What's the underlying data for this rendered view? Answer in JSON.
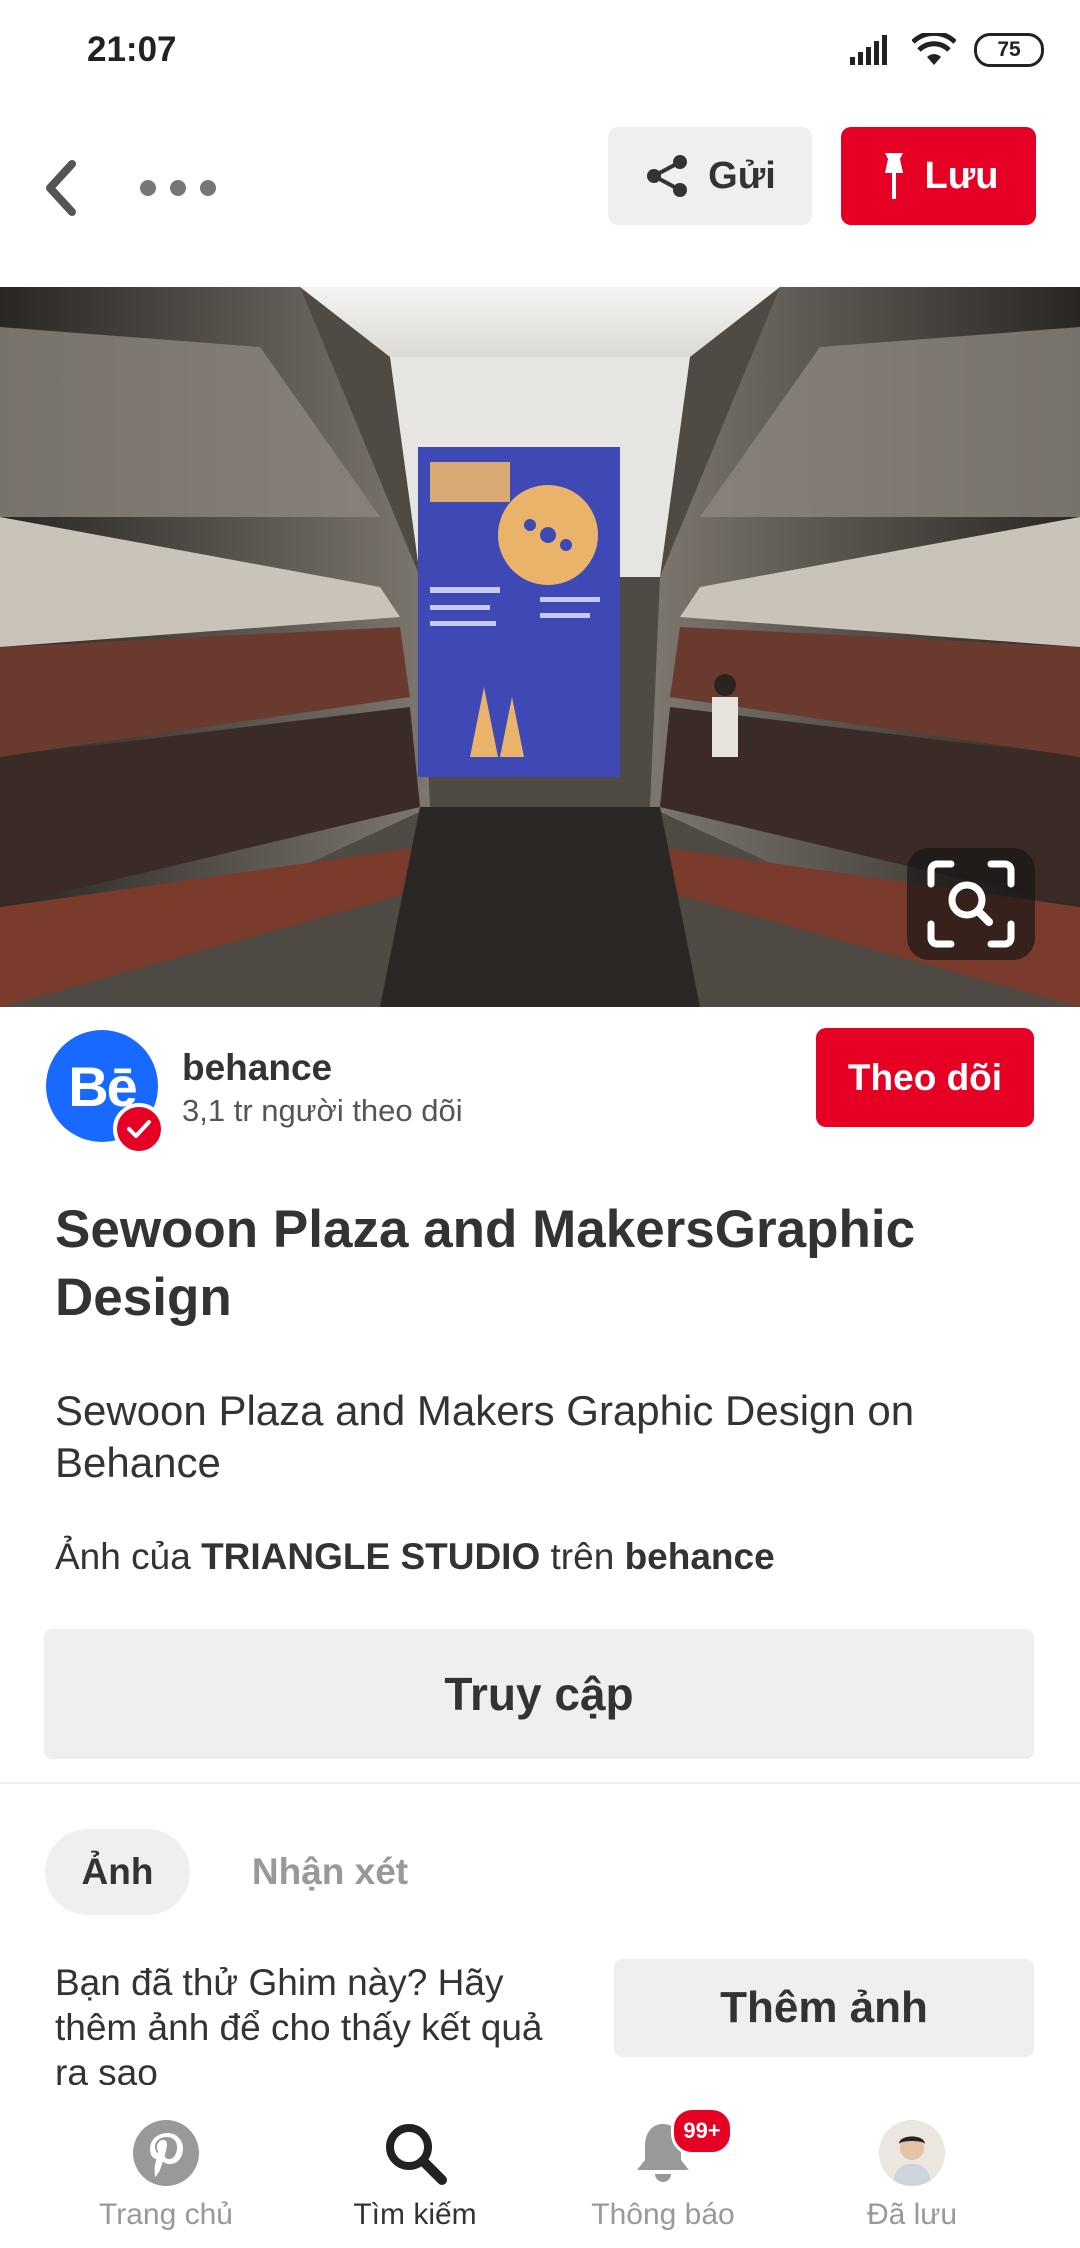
{
  "status_bar": {
    "time": "21:07",
    "battery": "75"
  },
  "top_bar": {
    "send_label": "Gửi",
    "save_label": "Lưu"
  },
  "creator": {
    "avatar_text": "Bē",
    "name": "behance",
    "followers": "3,1 tr người theo dõi",
    "follow_label": "Theo dõi"
  },
  "pin": {
    "title": "Sewoon Plaza and MakersGraphic Design",
    "description": "Sewoon Plaza and Makers Graphic Design on Behance",
    "attribution_prefix": "Ảnh của ",
    "attribution_author": "TRIANGLE STUDIO",
    "attribution_middle": " trên ",
    "attribution_source": "behance",
    "visit_label": "Truy cập"
  },
  "tabs": {
    "photos": "Ảnh",
    "comments": "Nhận xét"
  },
  "tried": {
    "text": "Bạn đã thử Ghim này? Hãy thêm ảnh để cho thấy kết quả ra sao",
    "add_photo_label": "Thêm ảnh"
  },
  "bottom_nav": {
    "items": [
      {
        "label": "Trang chủ"
      },
      {
        "label": "Tìm kiếm"
      },
      {
        "label": "Thông báo",
        "badge": "99+"
      },
      {
        "label": "Đã lưu"
      }
    ]
  },
  "colors": {
    "brand_red": "#e60023",
    "behance_blue": "#1769ff",
    "button_gray": "#efefef"
  },
  "icons": [
    "back-arrow-icon",
    "more-icon",
    "share-icon",
    "pin-icon",
    "visual-search-icon",
    "verified-check-icon",
    "pinterest-logo-icon",
    "search-icon",
    "bell-icon",
    "wifi-icon",
    "signal-icon"
  ]
}
